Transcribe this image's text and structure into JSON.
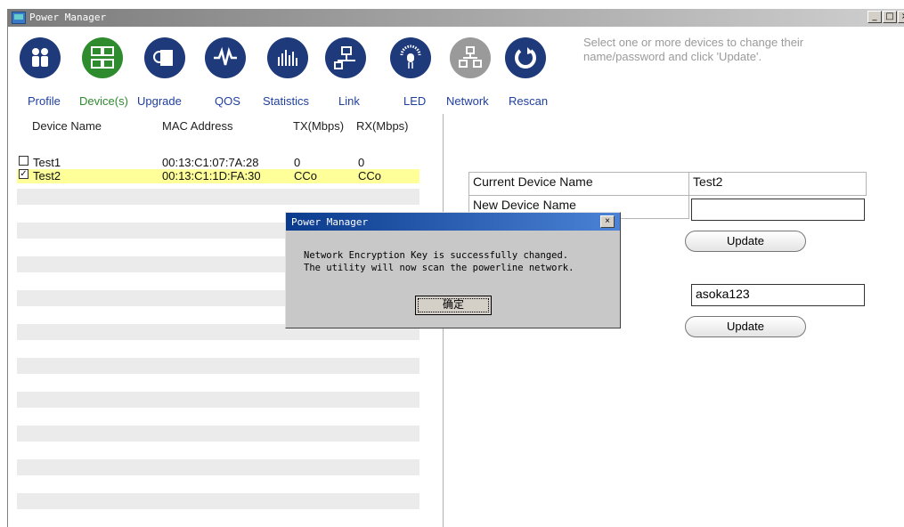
{
  "window": {
    "title": "Power Manager"
  },
  "toolbar": {
    "items": [
      {
        "label": "Profile",
        "icon": "people-icon",
        "color": "#1f3a7a"
      },
      {
        "label": "Device(s)",
        "icon": "devices-icon",
        "color": "#2e8b2e"
      },
      {
        "label": "Upgrade",
        "icon": "upgrade-icon",
        "color": "#1f3a7a"
      },
      {
        "label": "QOS",
        "icon": "waveform-icon",
        "color": "#1f3a7a"
      },
      {
        "label": "Statistics",
        "icon": "bars-icon",
        "color": "#1f3a7a"
      },
      {
        "label": "Link",
        "icon": "link-icon",
        "color": "#1f3a7a"
      },
      {
        "label": "LED",
        "icon": "led-icon",
        "color": "#1f3a7a"
      },
      {
        "label": "Network",
        "icon": "network-icon",
        "color": "#9a9a9a"
      },
      {
        "label": "Rescan",
        "icon": "rescan-icon",
        "color": "#1f3a7a"
      }
    ],
    "instruction": "Select one or more devices to change their name/password and click 'Update'."
  },
  "device_table": {
    "headers": [
      "Device Name",
      "MAC Address",
      "TX(Mbps)",
      "RX(Mbps)"
    ],
    "rows": [
      {
        "checked": false,
        "name": "Test1",
        "mac": "00:13:C1:07:7A:28",
        "tx": "0",
        "rx": "0"
      },
      {
        "checked": true,
        "name": "Test2",
        "mac": "00:13:C1:1D:FA:30",
        "tx": "CCo",
        "rx": "CCo"
      }
    ]
  },
  "settings": {
    "current_name_label": "Current Device Name",
    "current_name_value": "Test2",
    "new_name_label": "New Device Name",
    "new_name_value": "",
    "update_label": "Update",
    "password_value": "asoka123",
    "update2_label": "Update"
  },
  "dialog": {
    "title": "Power Manager",
    "line1": "Network Encryption Key is successfully changed.",
    "line2": "The utility will now scan the powerline network.",
    "ok_label": "确定"
  }
}
